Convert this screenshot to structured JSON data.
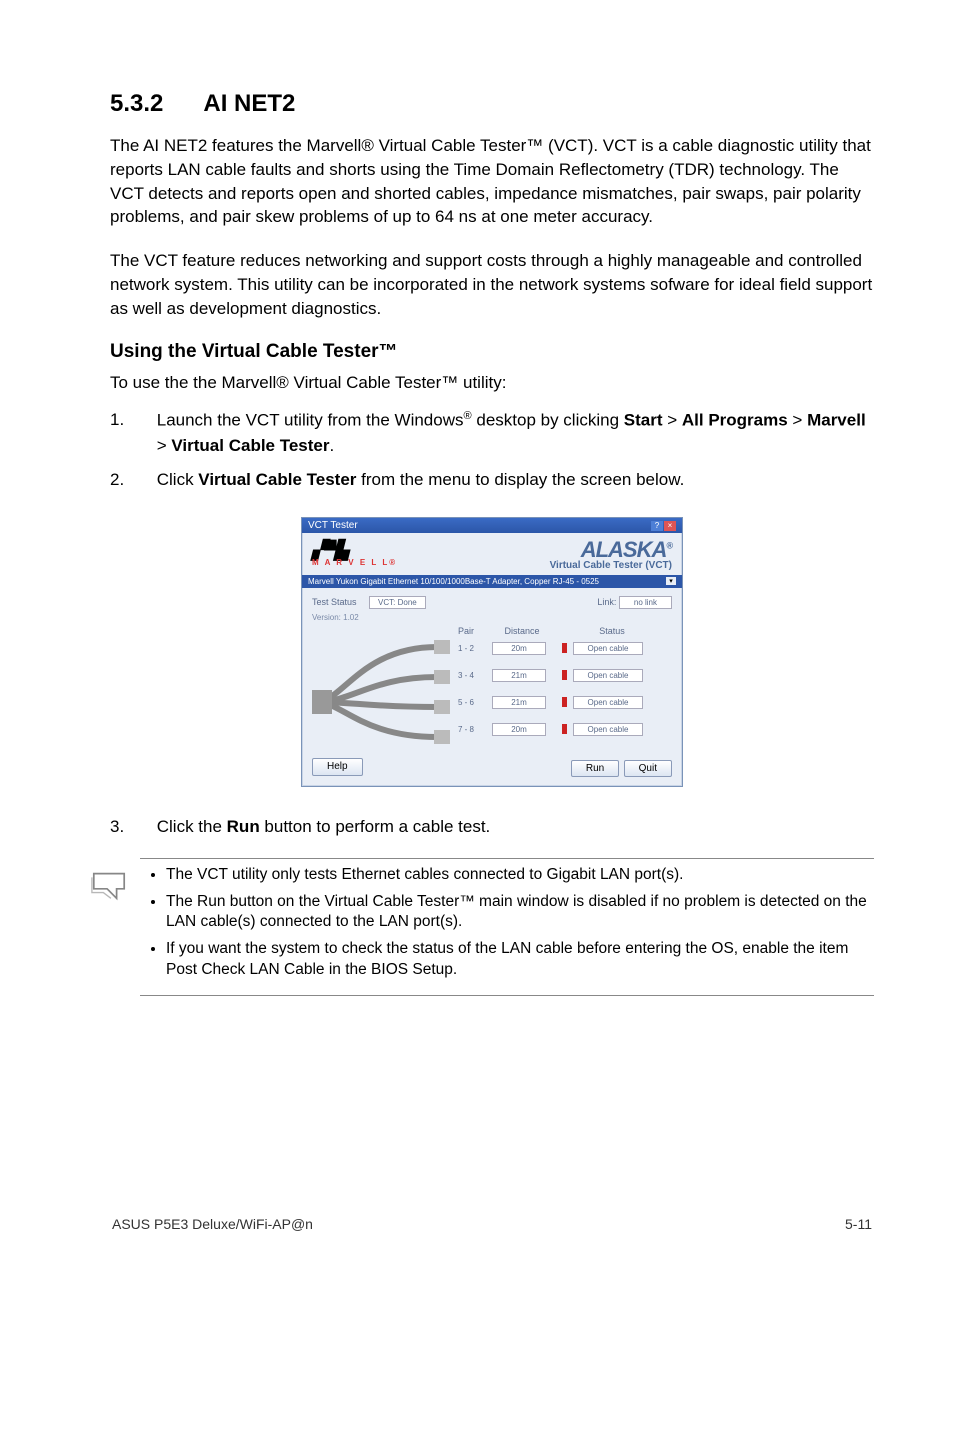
{
  "section": {
    "number": "5.3.2",
    "title": "AI NET2"
  },
  "para1": "The AI NET2 features the Marvell® Virtual Cable Tester™ (VCT). VCT is a cable diagnostic utility that reports LAN cable faults and shorts using the Time Domain Reflectometry (TDR) technology. The VCT detects and reports open and shorted cables, impedance mismatches, pair swaps, pair polarity problems, and pair skew problems of up to 64 ns at one meter accuracy.",
  "para2": "The VCT feature reduces networking and support costs through a highly manageable and controlled network system. This utility can be incorporated in the network systems sofware for ideal field support as well as development diagnostics.",
  "subhead": "Using the Virtual Cable Tester™",
  "subline": "To use the the Marvell® Virtual Cable Tester™ utility:",
  "steps": {
    "s1_pre": "Launch the VCT utility from the Windows",
    "s1_sup": "®",
    "s1_mid": " desktop by clicking ",
    "s1_b1": "Start",
    "s1_gt1": " > ",
    "s1_b2": "All Programs",
    "s1_gt2": " > ",
    "s1_b3": "Marvell",
    "s1_gt3": " > ",
    "s1_b4": "Virtual Cable Tester",
    "s1_end": ".",
    "s2_pre": "Click ",
    "s2_b": "Virtual Cable Tester",
    "s2_post": " from the menu to display the screen below.",
    "s3_pre": "Click the ",
    "s3_b": "Run",
    "s3_post": " button to perform a cable test."
  },
  "window": {
    "titlebar": "VCT Tester",
    "logo_small": "M A R V E L L®",
    "alaska": "ALASKA",
    "alaska_sub": "Virtual Cable Tester (VCT)",
    "bluestrip": "Marvell Yukon Gigabit Ethernet 10/100/1000Base-T Adapter, Copper RJ-45 - 0525",
    "test_status_label": "Test Status",
    "test_status_val": "VCT: Done",
    "version": "Version: 1.02",
    "link_label": "Link:",
    "link_val": "no link",
    "hdr_pair": "Pair",
    "hdr_dist": "Distance",
    "hdr_stat": "Status",
    "rows": [
      {
        "pair": "1 - 2",
        "dist": "20m",
        "stat": "Open cable"
      },
      {
        "pair": "3 - 4",
        "dist": "21m",
        "stat": "Open cable"
      },
      {
        "pair": "5 - 6",
        "dist": "21m",
        "stat": "Open cable"
      },
      {
        "pair": "7 - 8",
        "dist": "20m",
        "stat": "Open cable"
      }
    ],
    "btn_help": "Help",
    "btn_run": "Run",
    "btn_quit": "Quit"
  },
  "notes": {
    "n1": "The VCT utility only tests Ethernet cables connected to Gigabit LAN port(s).",
    "n2": "The Run button on the Virtual Cable Tester™ main window is disabled if no problem is detected on the LAN cable(s) connected to the LAN port(s).",
    "n3": "If you want the system to check the status of the LAN cable before entering the OS, enable the item Post Check LAN Cable in the BIOS Setup."
  },
  "footer": {
    "left": "ASUS P5E3 Deluxe/WiFi-AP@n",
    "right": "5-11"
  }
}
